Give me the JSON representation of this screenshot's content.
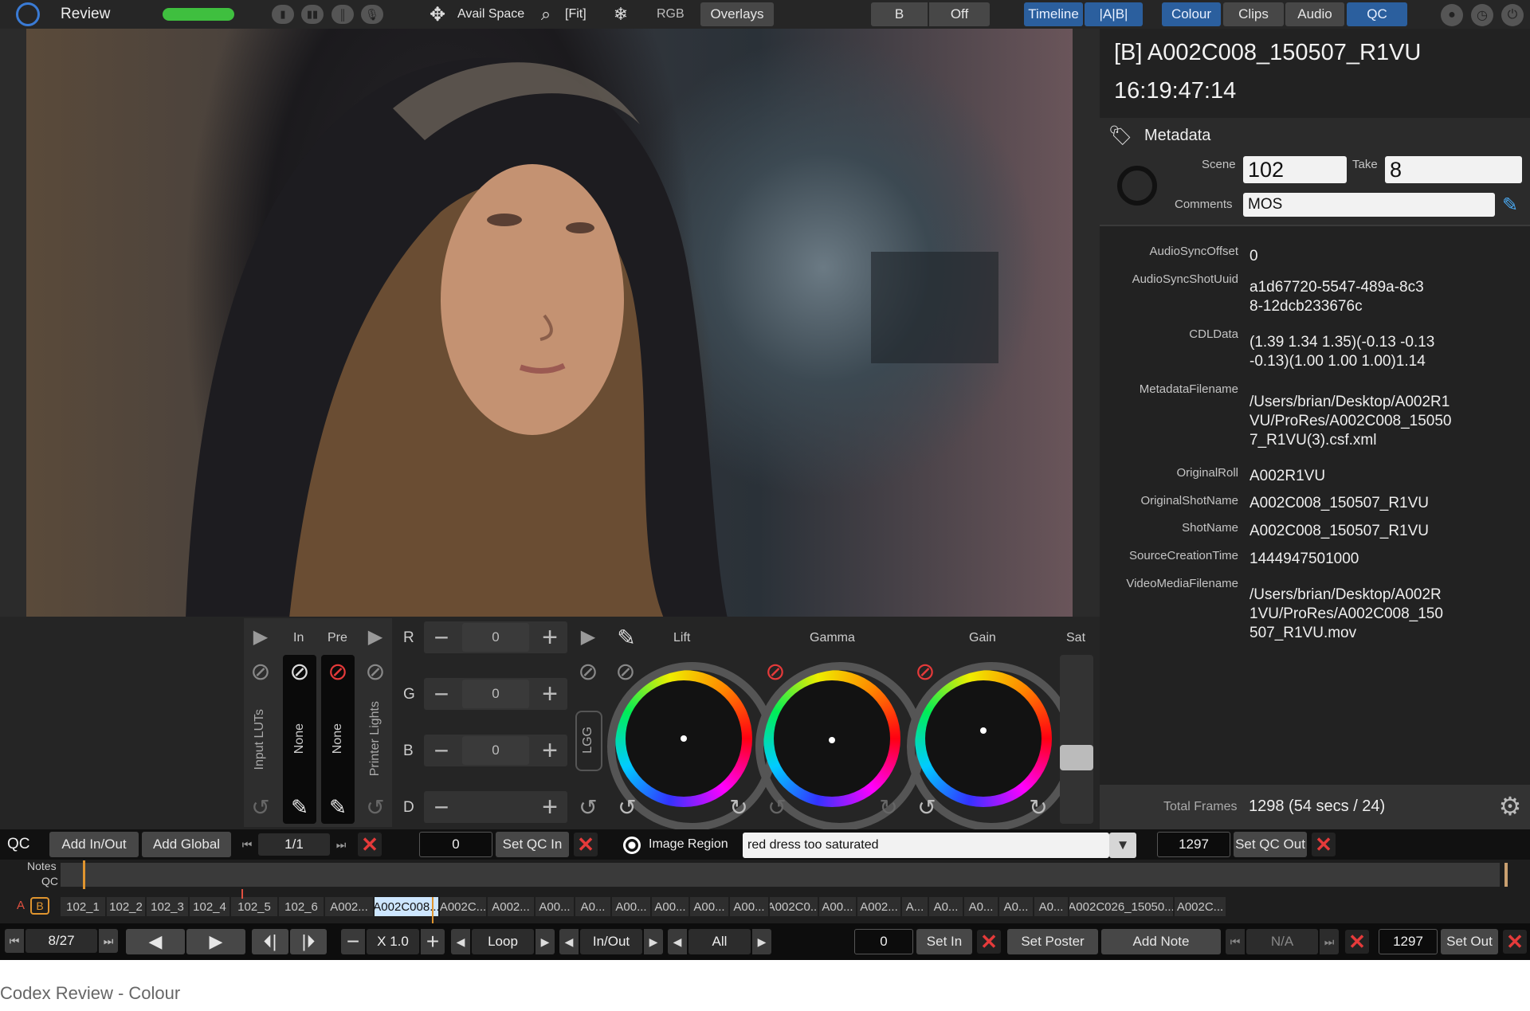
{
  "app": {
    "title": "Review"
  },
  "topbar": {
    "avail_space": "Avail Space",
    "fit": "[Fit]",
    "rgb": "RGB",
    "overlays": "Overlays",
    "b": "B",
    "off": "Off",
    "timeline": "Timeline",
    "ab": "|A|B|",
    "colour": "Colour",
    "clips": "Clips",
    "audio": "Audio",
    "qc": "QC"
  },
  "clip": {
    "name": "[B] A002C008_150507_R1VU",
    "timecode": "16:19:47:14"
  },
  "metadata": {
    "heading": "Metadata",
    "scene_label": "Scene",
    "scene": "102",
    "take_label": "Take",
    "take": "8",
    "comments_label": "Comments",
    "comments": "MOS",
    "fields": [
      {
        "key": "AudioSyncOffset",
        "value": "0"
      },
      {
        "key": "AudioSyncShotUuid",
        "value": "a1d67720-5547-489a-8c38-12dcb233676c"
      },
      {
        "key": "CDLData",
        "value": "(1.39 1.34 1.35)(-0.13 -0.13 -0.13)(1.00 1.00 1.00)1.14"
      },
      {
        "key": "MetadataFilename",
        "value": "/Users/brian/Desktop/A002R1VU/ProRes/A002C008_150507_R1VU(3).csf.xml"
      },
      {
        "key": "OriginalRoll",
        "value": "A002R1VU"
      },
      {
        "key": "OriginalShotName",
        "value": "A002C008_150507_R1VU"
      },
      {
        "key": "ShotName",
        "value": "A002C008_150507_R1VU"
      },
      {
        "key": "SourceCreationTime",
        "value": "1444947501000"
      },
      {
        "key": "VideoMediaFilename",
        "value": "/Users/brian/Desktop/A002R1VU/ProRes/A002C008_150507_R1VU.mov"
      }
    ],
    "total_frames_label": "Total Frames",
    "total_frames": "1298 (54 secs / 24)"
  },
  "colour": {
    "in": "In",
    "pre": "Pre",
    "input_luts": "Input LUTs",
    "none1": "None",
    "none2": "None",
    "printer_lights": "Printer Lights",
    "r": "R",
    "g": "G",
    "b": "B",
    "d": "D",
    "r_val": "0",
    "g_val": "0",
    "b_val": "0",
    "lgg": "LGG",
    "lift": "Lift",
    "gamma": "Gamma",
    "gain": "Gain",
    "sat": "Sat"
  },
  "qc": {
    "label": "QC",
    "add_in_out": "Add In/Out",
    "add_global": "Add Global",
    "page": "1/1",
    "in_val": "0",
    "set_qc_in": "Set QC In",
    "image_region": "Image Region",
    "note": "red dress too saturated",
    "out_val": "1297",
    "set_qc_out": "Set QC Out"
  },
  "timeline": {
    "notes": "Notes",
    "qc": "QC",
    "a": "A",
    "b": "B",
    "clips": [
      "102_1",
      "102_2",
      "102_3",
      "102_4",
      "102_5",
      "102_6",
      "A002...",
      "A002C008...",
      "A002C...",
      "A002...",
      "A00...",
      "A0...",
      "A00...",
      "A00...",
      "A00...",
      "A00...",
      "A002C0...",
      "A00...",
      "A002...",
      "A...",
      "A0...",
      "A0...",
      "A0...",
      "A0...",
      "A002C026_15050...",
      "A002C..."
    ]
  },
  "transport": {
    "clip_pos": "8/27",
    "speed": "X 1.0",
    "loop": "Loop",
    "inout": "In/Out",
    "all": "All",
    "in_val": "0",
    "set_in": "Set In",
    "set_poster": "Set Poster",
    "add_note": "Add Note",
    "na": "N/A",
    "out_val": "1297",
    "set_out": "Set Out"
  },
  "caption": "Codex Review - Colour",
  "colors": {
    "accent": "#2b5f9e",
    "progress": "#3fbf3f",
    "cancel": "#e53a3a",
    "highlight_clip": "#cde6ff"
  }
}
